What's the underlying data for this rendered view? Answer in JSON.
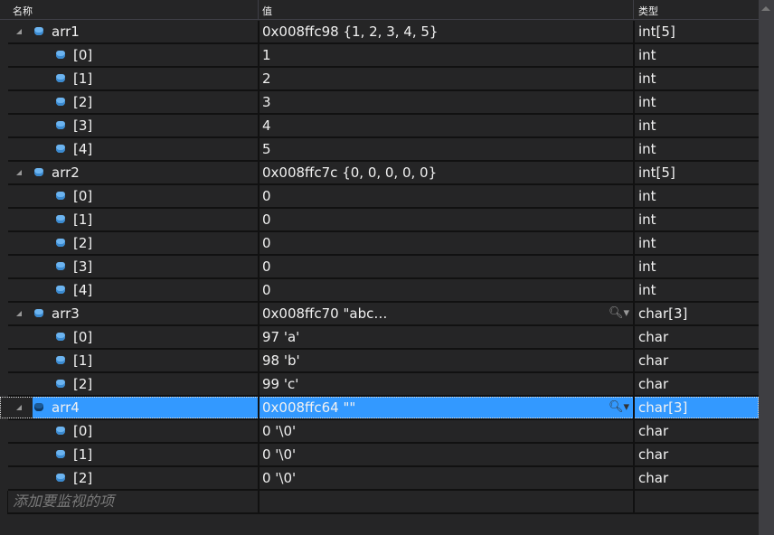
{
  "columns": {
    "name": "名称",
    "value": "值",
    "type": "类型"
  },
  "rows": [
    {
      "name": "arr1",
      "value": "0x008ffc98 {1, 2, 3, 4, 5}",
      "type": "int[5]",
      "level": 0
    },
    {
      "name": "[0]",
      "value": "1",
      "type": "int",
      "level": 1
    },
    {
      "name": "[1]",
      "value": "2",
      "type": "int",
      "level": 1
    },
    {
      "name": "[2]",
      "value": "3",
      "type": "int",
      "level": 1
    },
    {
      "name": "[3]",
      "value": "4",
      "type": "int",
      "level": 1
    },
    {
      "name": "[4]",
      "value": "5",
      "type": "int",
      "level": 1
    },
    {
      "name": "arr2",
      "value": "0x008ffc7c {0, 0, 0, 0, 0}",
      "type": "int[5]",
      "level": 0
    },
    {
      "name": "[0]",
      "value": "0",
      "type": "int",
      "level": 1
    },
    {
      "name": "[1]",
      "value": "0",
      "type": "int",
      "level": 1
    },
    {
      "name": "[2]",
      "value": "0",
      "type": "int",
      "level": 1
    },
    {
      "name": "[3]",
      "value": "0",
      "type": "int",
      "level": 1
    },
    {
      "name": "[4]",
      "value": "0",
      "type": "int",
      "level": 1
    },
    {
      "name": "arr3",
      "value": "0x008ffc70 \"abc…",
      "type": "char[3]",
      "level": 0,
      "visualizer": true
    },
    {
      "name": "[0]",
      "value": "97 'a'",
      "type": "char",
      "level": 1
    },
    {
      "name": "[1]",
      "value": "98 'b'",
      "type": "char",
      "level": 1
    },
    {
      "name": "[2]",
      "value": "99 'c'",
      "type": "char",
      "level": 1
    },
    {
      "name": "arr4",
      "value": "0x008ffc64 \"\"",
      "type": "char[3]",
      "level": 0,
      "visualizer": true,
      "selected": true
    },
    {
      "name": "[0]",
      "value": "0 '\\0'",
      "type": "char",
      "level": 1
    },
    {
      "name": "[1]",
      "value": "0 '\\0'",
      "type": "char",
      "level": 1
    },
    {
      "name": "[2]",
      "value": "0 '\\0'",
      "type": "char",
      "level": 1
    }
  ],
  "add_item_placeholder": "添加要监视的项",
  "colors": {
    "background": "#252526",
    "selection": "#3399ff",
    "icon": "#6cb4f0"
  }
}
